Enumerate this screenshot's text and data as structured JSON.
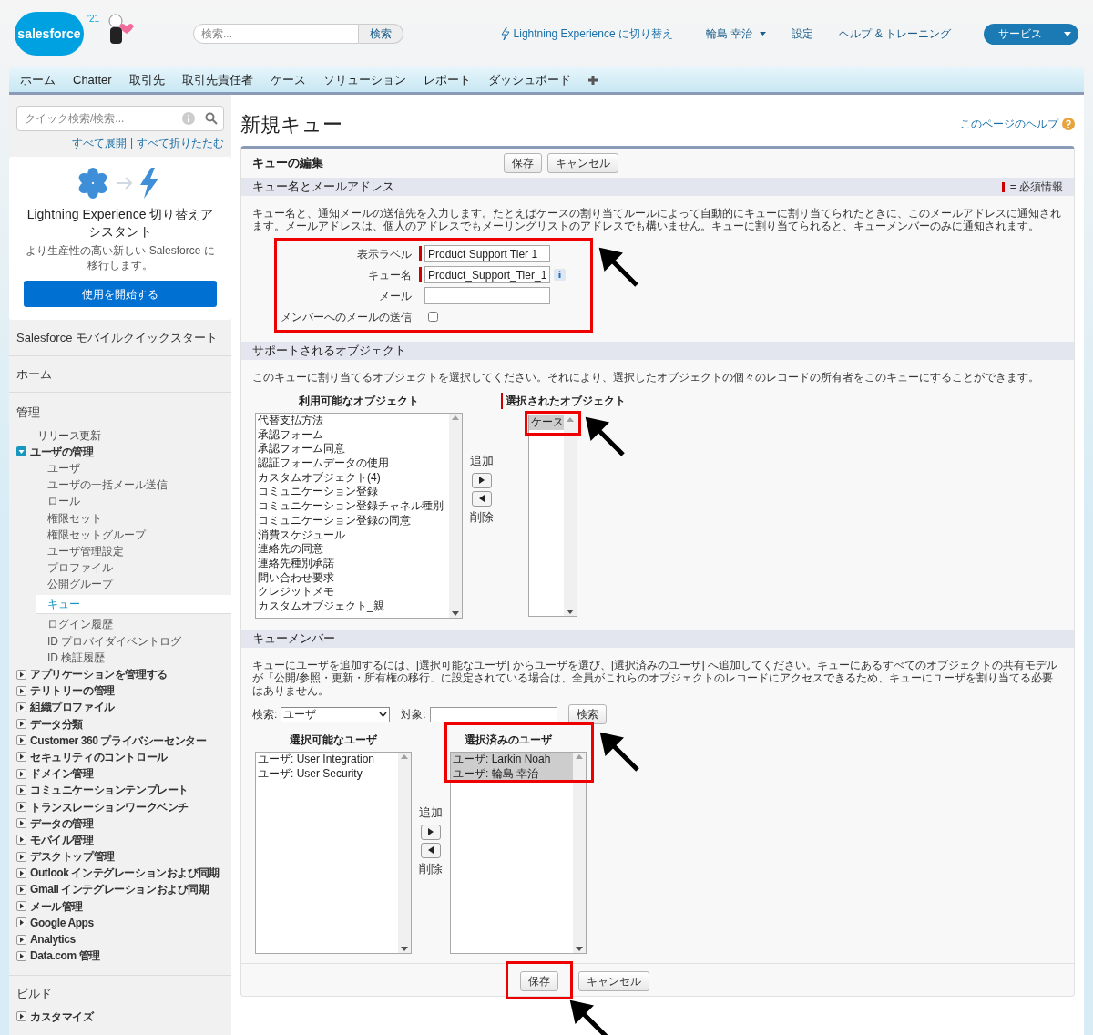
{
  "header": {
    "logo": "salesforce",
    "logo_year": "'21",
    "search": {
      "placeholder": "検索..."
    },
    "search_button": "検索",
    "lightning_link": "Lightning Experience に切り替え",
    "user_menu": "輪島 幸治",
    "setup": "設定",
    "help": "ヘルプ & トレーニング",
    "app_menu": "サービス"
  },
  "tabs": [
    {
      "label": "ホーム",
      "selected": false
    },
    {
      "label": "Chatter",
      "selected": false
    },
    {
      "label": "取引先",
      "selected": false
    },
    {
      "label": "取引先責任者",
      "selected": false
    },
    {
      "label": "ケース",
      "selected": false
    },
    {
      "label": "ソリューション",
      "selected": false
    },
    {
      "label": "レポート",
      "selected": false
    },
    {
      "label": "ダッシュボード",
      "selected": false
    }
  ],
  "sidebar": {
    "quick_search": {
      "placeholder": "クイック検索/検索..."
    },
    "expand_all": "すべて展開",
    "separator": "|",
    "collapse_all": "すべて折りたたむ",
    "promo": {
      "title": "Lightning Experience 切り替えアシスタント",
      "text": "より生産性の高い新しい Salesforce に移行します。",
      "button": "使用を開始する"
    },
    "sections": [
      {
        "title": "Salesforce モバイルクイックスタート"
      },
      {
        "title": "ホーム"
      }
    ],
    "admin": {
      "title": "管理",
      "items": [
        {
          "label": "リリース更新",
          "kind": "link"
        },
        {
          "label": "ユーザの管理",
          "kind": "folder",
          "expanded": true,
          "children": [
            {
              "label": "ユーザ",
              "selected": false
            },
            {
              "label": "ユーザの一括メール送信",
              "selected": false
            },
            {
              "label": "ロール",
              "selected": false
            },
            {
              "label": "権限セット",
              "selected": false
            },
            {
              "label": "権限セットグループ",
              "selected": false
            },
            {
              "label": "ユーザ管理設定",
              "selected": false
            },
            {
              "label": "プロファイル",
              "selected": false
            },
            {
              "label": "公開グループ",
              "selected": false
            },
            {
              "label": "キュー",
              "selected": true
            },
            {
              "label": "ログイン履歴",
              "selected": false
            },
            {
              "label": "ID プロバイダイベントログ",
              "selected": false
            },
            {
              "label": "ID 検証履歴",
              "selected": false
            }
          ]
        },
        {
          "label": "アプリケーションを管理する",
          "kind": "folder",
          "expanded": false
        },
        {
          "label": "テリトリーの管理",
          "kind": "folder",
          "expanded": false
        },
        {
          "label": "組織プロファイル",
          "kind": "folder",
          "expanded": false
        },
        {
          "label": "データ分類",
          "kind": "folder",
          "expanded": false
        },
        {
          "label": "Customer 360 プライバシーセンター",
          "kind": "folder",
          "expanded": false
        },
        {
          "label": "セキュリティのコントロール",
          "kind": "folder",
          "expanded": false
        },
        {
          "label": "ドメイン管理",
          "kind": "folder",
          "expanded": false
        },
        {
          "label": "コミュニケーションテンプレート",
          "kind": "folder",
          "expanded": false
        },
        {
          "label": "トランスレーションワークベンチ",
          "kind": "folder",
          "expanded": false
        },
        {
          "label": "データの管理",
          "kind": "folder",
          "expanded": false
        },
        {
          "label": "モバイル管理",
          "kind": "folder",
          "expanded": false
        },
        {
          "label": "デスクトップ管理",
          "kind": "folder",
          "expanded": false
        },
        {
          "label": "Outlook インテグレーションおよび同期",
          "kind": "folder",
          "expanded": false
        },
        {
          "label": "Gmail インテグレーションおよび同期",
          "kind": "folder",
          "expanded": false
        },
        {
          "label": "メール管理",
          "kind": "folder",
          "expanded": false
        },
        {
          "label": "Google Apps",
          "kind": "folder",
          "expanded": false
        },
        {
          "label": "Analytics",
          "kind": "folder",
          "expanded": false
        },
        {
          "label": "Data.com 管理",
          "kind": "folder",
          "expanded": false
        }
      ]
    },
    "build": {
      "title": "ビルド",
      "items": [
        {
          "label": "カスタマイズ",
          "kind": "folder",
          "expanded": false
        }
      ]
    }
  },
  "page": {
    "title": "新規キュー",
    "help_link": "このページのヘルプ",
    "edit": {
      "title": "キューの編集",
      "buttons": [
        "保存",
        "キャンセル"
      ]
    },
    "name_section": {
      "title": "キュー名とメールアドレス",
      "required_legend": "= 必須情報",
      "description": "キュー名と、通知メールの送信先を入力します。たとえばケースの割り当てルールによって自動的にキューに割り当てられたときに、このメールアドレスに通知されます。メールアドレスは、個人のアドレスでもメーリングリストのアドレスでも構いません。キューに割り当てられると、キューメンバーのみに通知されます。",
      "highlighted": true,
      "fields": [
        {
          "label": "表示ラベル",
          "kind": "text",
          "value": "Product Support Tier 1",
          "required": true,
          "info": false
        },
        {
          "label": "キュー名",
          "kind": "text",
          "value": "Product_Support_Tier_1",
          "required": true,
          "info": true
        },
        {
          "label": "メール",
          "kind": "text",
          "required": false,
          "info": false
        },
        {
          "label": "メンバーへのメールの送信",
          "kind": "checkbox",
          "checked": false,
          "required": false,
          "info": false
        }
      ]
    },
    "objects_section": {
      "title": "サポートされるオブジェクト",
      "description": "このキューに割り当てるオブジェクトを選択してください。それにより、選択したオブジェクトの個々のレコードの所有者をこのキューにすることができます。",
      "available_title": "利用可能なオブジェクト",
      "available": [
        "代替支払方法",
        "承認フォーム",
        "承認フォーム同意",
        "認証フォームデータの使用",
        "カスタムオブジェクト(4)",
        "コミュニケーション登録",
        "コミュニケーション登録チャネル種別",
        "コミュニケーション登録の同意",
        "消費スケジュール",
        "連絡先の同意",
        "連絡先種別承諾",
        "問い合わせ要求",
        "クレジットメモ",
        "カスタムオブジェクト_親"
      ],
      "add": "追加",
      "remove": "削除",
      "selected_title": "選択されたオブジェクト",
      "selected_required": true,
      "selected_highlighted": true,
      "selected": [
        {
          "label": "ケース",
          "selected": true
        }
      ]
    },
    "members_section": {
      "title": "キューメンバー",
      "description": "キューにユーザを追加するには、[選択可能なユーザ] からユーザを選び、[選択済みのユーザ] へ追加してください。キューにあるすべてのオブジェクトの共有モデルが「公開/参照・更新・所有権の移行」に設定されている場合は、全員がこれらのオブジェクトのレコードにアクセスできるため、キューにユーザを割り当てる必要はありません。",
      "search_label": "検索:",
      "search_type": "ユーザ",
      "target_label": "対象:",
      "search_button": "検索",
      "available_title": "選択可能なユーザ",
      "available": [
        "ユーザ: User Integration",
        "ユーザ: User Security"
      ],
      "add": "追加",
      "remove": "削除",
      "selected_title": "選択済みのユーザ",
      "selected_highlighted": true,
      "selected": [
        {
          "label": "ユーザ: Larkin Noah",
          "selected": true
        },
        {
          "label": "ユーザ: 輪島 幸治",
          "selected": true
        }
      ]
    },
    "footer_buttons": [
      {
        "label": "保存",
        "highlighted": true
      },
      {
        "label": "キャンセル",
        "highlighted": false
      }
    ]
  }
}
